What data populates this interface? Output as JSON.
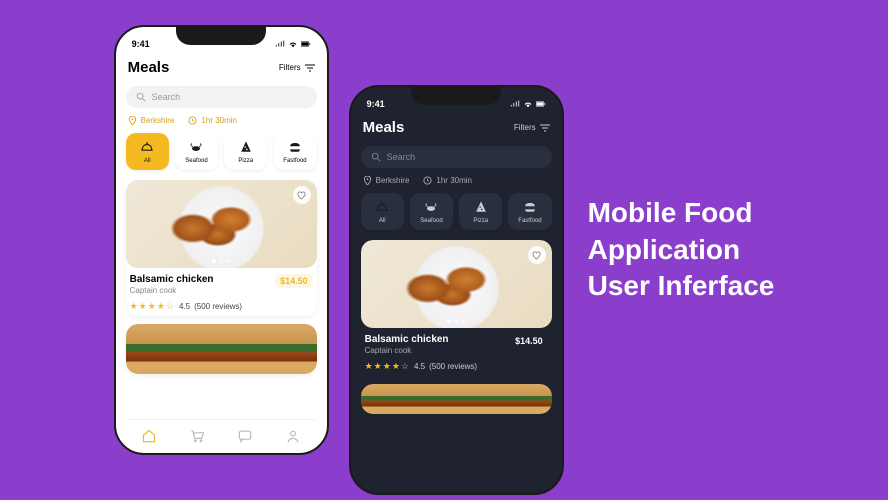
{
  "hero": {
    "line1": "Mobile Food",
    "line2": "Application",
    "line3": "User Inferface"
  },
  "status": {
    "time": "9:41"
  },
  "header": {
    "title": "Meals",
    "filters_label": "Filters"
  },
  "search": {
    "placeholder": "Search"
  },
  "info": {
    "location": "Berkshire",
    "time": "1hr 30min"
  },
  "categories": [
    {
      "label": "All",
      "icon": "serving-lid-icon",
      "active": true
    },
    {
      "label": "Seafood",
      "icon": "crab-icon",
      "active": false
    },
    {
      "label": "Pizza",
      "icon": "pizza-icon",
      "active": false
    },
    {
      "label": "Fastfood",
      "icon": "burger-icon",
      "active": false
    }
  ],
  "meal": {
    "name": "Balsamic chicken",
    "cook": "Captain cook",
    "price": "$14.50",
    "rating": "4.5",
    "reviews": "(500 reviews)"
  },
  "colors": {
    "accent": "#f5b921",
    "bg_light": "#ffffff",
    "bg_dark": "#1f2330",
    "page": "#8b3dcc"
  }
}
